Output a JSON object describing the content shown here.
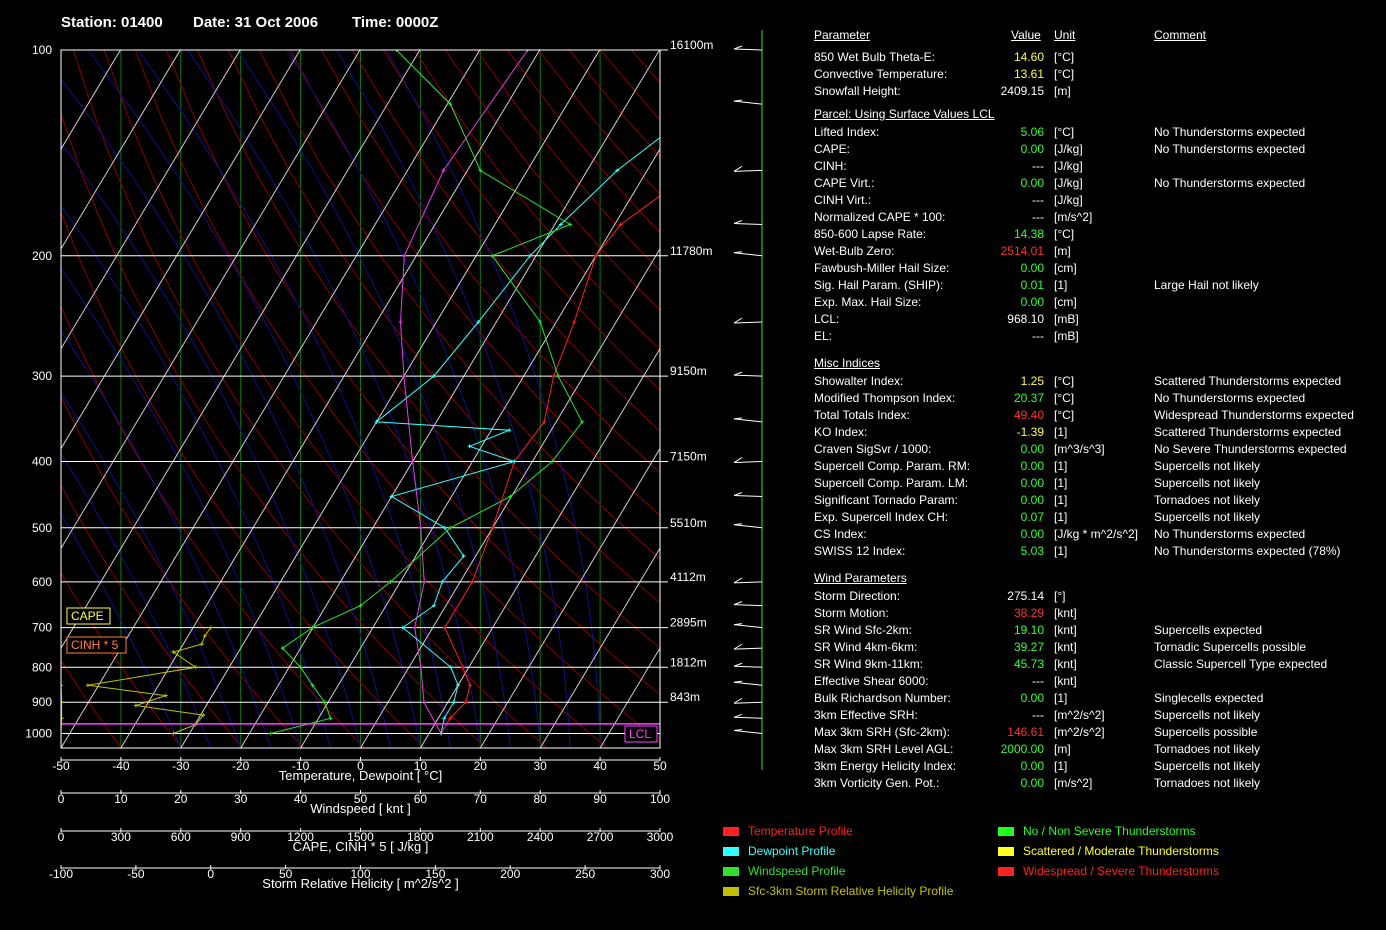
{
  "header": {
    "station": "Station: 01400",
    "date": "Date: 31 Oct 2006",
    "time": "Time: 0000Z"
  },
  "params_header": {
    "parameter": "Parameter",
    "value": "Value",
    "unit": "Unit",
    "comment": "Comment"
  },
  "sections": [
    {
      "title": "",
      "rows": [
        {
          "name": "850 Wet Bulb Theta-E:",
          "value": "14.60",
          "unit": "[°C]",
          "comment": "",
          "color": "#ffff40"
        },
        {
          "name": "Convective Temperature:",
          "value": "13.61",
          "unit": "[°C]",
          "comment": "",
          "color": "#ffff40"
        },
        {
          "name": "Snowfall Height:",
          "value": "2409.15",
          "unit": "[m]",
          "comment": "",
          "color": "#ffffff"
        }
      ]
    },
    {
      "title": "Parcel: Using Surface Values LCL",
      "rows": [
        {
          "name": "Lifted Index:",
          "value": "5.06",
          "unit": "[°C]",
          "comment": "No Thunderstorms expected",
          "color": "#30ff30"
        },
        {
          "name": "CAPE:",
          "value": "0.00",
          "unit": "[J/kg]",
          "comment": "No Thunderstorms expected",
          "color": "#30ff30"
        },
        {
          "name": "CINH:",
          "value": "---",
          "unit": "[J/kg]",
          "comment": "",
          "color": "#ffffff"
        },
        {
          "name": "CAPE Virt.:",
          "value": "0.00",
          "unit": "[J/kg]",
          "comment": "No Thunderstorms expected",
          "color": "#30ff30"
        },
        {
          "name": "CINH Virt.:",
          "value": "---",
          "unit": "[J/kg]",
          "comment": "",
          "color": "#ffffff"
        },
        {
          "name": "Normalized CAPE * 100:",
          "value": "---",
          "unit": "[m/s^2]",
          "comment": "",
          "color": "#ffffff"
        },
        {
          "name": "850-600 Lapse Rate:",
          "value": "14.38",
          "unit": "[°C]",
          "comment": "",
          "color": "#30ff30"
        },
        {
          "name": "Wet-Bulb Zero:",
          "value": "2514.01",
          "unit": "[m]",
          "comment": "",
          "color": "#ff3030"
        },
        {
          "name": "Fawbush-Miller Hail Size:",
          "value": "0.00",
          "unit": "[cm]",
          "comment": "",
          "color": "#30ff30"
        },
        {
          "name": "Sig. Hail Param. (SHIP):",
          "value": "0.01",
          "unit": "[1]",
          "comment": "Large Hail not likely",
          "color": "#30ff30"
        },
        {
          "name": "Exp. Max. Hail Size:",
          "value": "0.00",
          "unit": "[cm]",
          "comment": "",
          "color": "#30ff30"
        },
        {
          "name": "LCL:",
          "value": "968.10",
          "unit": "[mB]",
          "comment": "",
          "color": "#ffffff"
        },
        {
          "name": "EL:",
          "value": "---",
          "unit": "[mB]",
          "comment": "",
          "color": "#ffffff"
        }
      ]
    },
    {
      "title": "Misc Indices",
      "rows": [
        {
          "name": "Showalter Index:",
          "value": "1.25",
          "unit": "[°C]",
          "comment": "Scattered Thunderstorms expected",
          "color": "#ffff40"
        },
        {
          "name": "Modified Thompson Index:",
          "value": "20.37",
          "unit": "[°C]",
          "comment": "No Thunderstorms expected",
          "color": "#30ff30"
        },
        {
          "name": "Total Totals Index:",
          "value": "49.40",
          "unit": "[°C]",
          "comment": "Widespread Thunderstorms expected",
          "color": "#ff3030"
        },
        {
          "name": "KO Index:",
          "value": "-1.39",
          "unit": "[1]",
          "comment": "Scattered Thunderstorms expected",
          "color": "#ffff40"
        },
        {
          "name": "Craven SigSvr / 1000:",
          "value": "0.00",
          "unit": "[m^3/s^3]",
          "comment": "No Severe Thunderstorms expected",
          "color": "#30ff30"
        },
        {
          "name": "Supercell Comp. Param. RM:",
          "value": "0.00",
          "unit": "[1]",
          "comment": "Supercells not likely",
          "color": "#30ff30"
        },
        {
          "name": "Supercell Comp. Param. LM:",
          "value": "0.00",
          "unit": "[1]",
          "comment": "Supercells not likely",
          "color": "#30ff30"
        },
        {
          "name": "Significant Tornado Param:",
          "value": "0.00",
          "unit": "[1]",
          "comment": "Tornadoes not likely",
          "color": "#30ff30"
        },
        {
          "name": "Exp. Supercell Index CH:",
          "value": "0.07",
          "unit": "[1]",
          "comment": "Supercells not likely",
          "color": "#30ff30"
        },
        {
          "name": "CS Index:",
          "value": "0.00",
          "unit": "[J/kg * m^2/s^2]",
          "comment": "No Thunderstorms expected",
          "color": "#30ff30"
        },
        {
          "name": "SWISS 12 Index:",
          "value": "5.03",
          "unit": "[1]",
          "comment": "No Thunderstorms expected (78%)",
          "color": "#30ff30"
        }
      ]
    },
    {
      "title": "Wind Parameters",
      "rows": [
        {
          "name": "Storm Direction:",
          "value": "275.14",
          "unit": "[°]",
          "comment": "",
          "color": "#ffffff"
        },
        {
          "name": "Storm Motion:",
          "value": "38.29",
          "unit": "[knt]",
          "comment": "",
          "color": "#ff3030"
        },
        {
          "name": "SR Wind Sfc-2km:",
          "value": "19.10",
          "unit": "[knt]",
          "comment": "Supercells expected",
          "color": "#30ff30"
        },
        {
          "name": "SR Wind 4km-6km:",
          "value": "39.27",
          "unit": "[knt]",
          "comment": "Tornadic Supercells possible",
          "color": "#30ff30"
        },
        {
          "name": "SR Wind 9km-11km:",
          "value": "45.73",
          "unit": "[knt]",
          "comment": "Classic Supercell Type expected",
          "color": "#30ff30"
        },
        {
          "name": "Effective Shear 6000:",
          "value": "---",
          "unit": "[knt]",
          "comment": "",
          "color": "#ffffff"
        },
        {
          "name": "Bulk Richardson Number:",
          "value": "0.00",
          "unit": "[1]",
          "comment": "Singlecells expected",
          "color": "#30ff30"
        },
        {
          "name": "3km Effective SRH:",
          "value": "---",
          "unit": "[m^2/s^2]",
          "comment": "Supercells not likely",
          "color": "#ffffff"
        },
        {
          "name": "Max 3km SRH (Sfc-2km):",
          "value": "146.61",
          "unit": "[m^2/s^2]",
          "comment": "Supercells possible",
          "color": "#ff3030"
        },
        {
          "name": "Max 3km SRH Level AGL:",
          "value": "2000.00",
          "unit": "[m]",
          "comment": "Tornadoes not likely",
          "color": "#30ff30"
        },
        {
          "name": "3km Energy Helicity Index:",
          "value": "0.00",
          "unit": "[1]",
          "comment": "Supercells not likely",
          "color": "#30ff30"
        },
        {
          "name": "3km Vorticity Gen. Pot.:",
          "value": "0.00",
          "unit": "[m/s^2]",
          "comment": "Tornadoes not likely",
          "color": "#30ff30"
        }
      ]
    }
  ],
  "legend": [
    {
      "label": "Temperature Profile",
      "color": "#ff2020"
    },
    {
      "label": "Dewpoint Profile",
      "color": "#30ffff"
    },
    {
      "label": "Windspeed Profile",
      "color": "#30e030"
    },
    {
      "label": "Sfc-3km Storm Relative Helicity Profile",
      "color": "#c0c000"
    },
    {
      "label": "No / Non Severe Thunderstorms",
      "color": "#20ff20"
    },
    {
      "label": "Scattered / Moderate Thunderstorms",
      "color": "#ffff20"
    },
    {
      "label": "Widespread / Severe Thunderstorms",
      "color": "#ff2020"
    }
  ],
  "chart_data": {
    "type": "line",
    "pressure_ticks": [
      100,
      200,
      300,
      400,
      500,
      600,
      700,
      800,
      900,
      1000
    ],
    "height_labels": [
      {
        "p": 100,
        "label": "16100m"
      },
      {
        "p": 200,
        "label": "11780m"
      },
      {
        "p": 300,
        "label": "9150m"
      },
      {
        "p": 400,
        "label": "7150m"
      },
      {
        "p": 500,
        "label": "5510m"
      },
      {
        "p": 600,
        "label": "4112m"
      },
      {
        "p": 700,
        "label": "2895m"
      },
      {
        "p": 800,
        "label": "1812m"
      },
      {
        "p": 900,
        "label": "843m"
      }
    ],
    "axes": [
      {
        "title": "Temperature, Dewpoint  [ °C]",
        "ticks": [
          "-50",
          "-40",
          "-30",
          "-20",
          "-10",
          "0",
          "10",
          "20",
          "30",
          "40",
          "50"
        ]
      },
      {
        "title": "Windspeed  [ knt ]",
        "ticks": [
          "0",
          "10",
          "20",
          "30",
          "40",
          "50",
          "60",
          "70",
          "80",
          "90",
          "100"
        ]
      },
      {
        "title": "CAPE, CINH * 5  [ J/kg ]",
        "ticks": [
          "0",
          "300",
          "600",
          "900",
          "1200",
          "1500",
          "1800",
          "2100",
          "2400",
          "2700",
          "3000"
        ]
      },
      {
        "title": "Storm Relative Helicity  [ m^2/s^2 ]",
        "ticks": [
          "-100",
          "-50",
          "0",
          "50",
          "100",
          "150",
          "200",
          "250",
          "300"
        ]
      }
    ],
    "xlim_temperature": [
      -50,
      50
    ],
    "ylim_pressure": [
      1050,
      100
    ],
    "lcl_pressure": 968.1,
    "labels": {
      "cape": "CAPE",
      "cinh": "CINH * 5",
      "lcl": "LCL"
    },
    "temperature": [
      [
        1000,
        12
      ],
      [
        950,
        12
      ],
      [
        900,
        13
      ],
      [
        850,
        12
      ],
      [
        800,
        9
      ],
      [
        700,
        2
      ],
      [
        600,
        2
      ],
      [
        500,
        0
      ],
      [
        400,
        -3
      ],
      [
        350,
        -2
      ],
      [
        300,
        -5
      ],
      [
        250,
        -7
      ],
      [
        200,
        -10
      ],
      [
        180,
        -9
      ],
      [
        150,
        -2
      ],
      [
        120,
        12
      ],
      [
        100,
        30
      ]
    ],
    "dewpoint": [
      [
        1000,
        12
      ],
      [
        950,
        11
      ],
      [
        900,
        11
      ],
      [
        850,
        10
      ],
      [
        800,
        7
      ],
      [
        700,
        -5
      ],
      [
        650,
        -2
      ],
      [
        600,
        -3
      ],
      [
        550,
        -2
      ],
      [
        500,
        -8
      ],
      [
        450,
        -20
      ],
      [
        400,
        -3
      ],
      [
        380,
        -12
      ],
      [
        360,
        -7
      ],
      [
        350,
        -30
      ],
      [
        300,
        -25
      ],
      [
        250,
        -23
      ],
      [
        200,
        -21
      ],
      [
        180,
        -19
      ],
      [
        150,
        -15
      ],
      [
        130,
        -10
      ],
      [
        100,
        12
      ]
    ],
    "windspeed": [
      [
        1000,
        35
      ],
      [
        950,
        45
      ],
      [
        900,
        44
      ],
      [
        850,
        42
      ],
      [
        800,
        40
      ],
      [
        750,
        37
      ],
      [
        700,
        42
      ],
      [
        650,
        50
      ],
      [
        600,
        55
      ],
      [
        500,
        65
      ],
      [
        450,
        75
      ],
      [
        400,
        82
      ],
      [
        350,
        87
      ],
      [
        300,
        83
      ],
      [
        250,
        80
      ],
      [
        200,
        72
      ],
      [
        180,
        85
      ],
      [
        150,
        70
      ],
      [
        120,
        65
      ],
      [
        100,
        56
      ]
    ],
    "parcel": [
      [
        1000,
        12
      ],
      [
        900,
        6
      ],
      [
        800,
        2
      ],
      [
        700,
        -3
      ],
      [
        600,
        -6
      ],
      [
        500,
        -12
      ],
      [
        400,
        -20
      ],
      [
        300,
        -30
      ],
      [
        250,
        -36
      ],
      [
        200,
        -42
      ],
      [
        150,
        -44
      ],
      [
        100,
        -42
      ]
    ],
    "srh": [
      [
        1000,
        -25
      ],
      [
        970,
        -10
      ],
      [
        940,
        -5
      ],
      [
        910,
        -50
      ],
      [
        880,
        -30
      ],
      [
        850,
        -82
      ],
      [
        800,
        -10
      ],
      [
        760,
        -25
      ],
      [
        740,
        -6
      ],
      [
        720,
        -4
      ],
      [
        700,
        0
      ]
    ],
    "cinh_curve": [
      [
        1000,
        0
      ],
      [
        950,
        3
      ],
      [
        900,
        3
      ],
      [
        850,
        0
      ]
    ]
  }
}
